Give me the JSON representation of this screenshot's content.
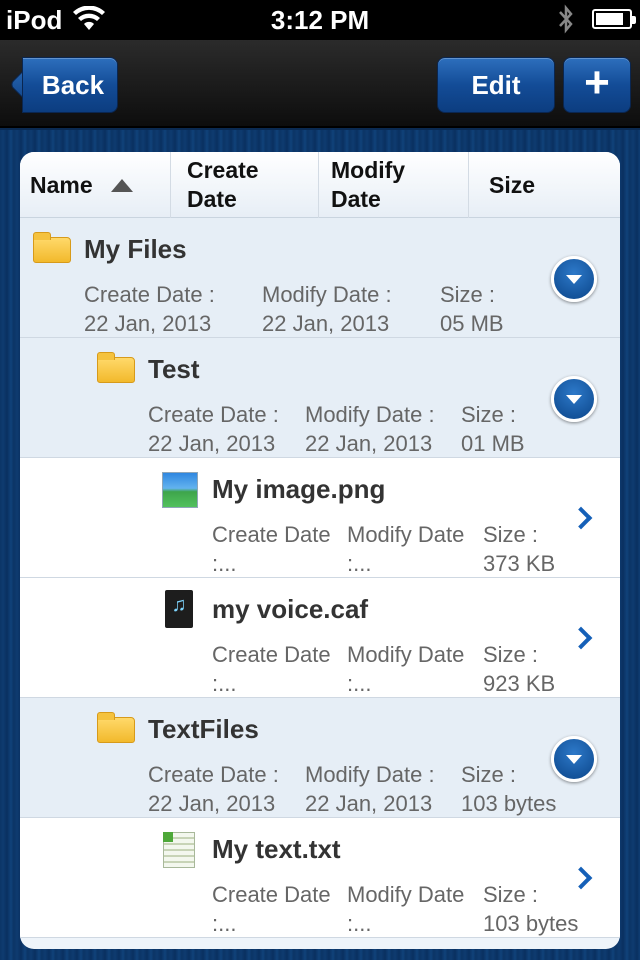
{
  "status_bar": {
    "carrier": "iPod",
    "time": "3:12 PM",
    "battery_level": 0.85
  },
  "nav_bar": {
    "back_label": "Back",
    "edit_label": "Edit",
    "add_label": "+"
  },
  "table_header": {
    "name": "Name",
    "create_date": "Create\nDate",
    "modify_date": "Modify\nDate",
    "size": "Size"
  },
  "rows": [
    {
      "type": "folder",
      "name": "My Files",
      "create_label": "Create Date :",
      "create_value": "22 Jan, 2013",
      "modify_label": "Modify Date :",
      "modify_value": "22 Jan, 2013",
      "size_label": "Size :",
      "size_value": "05 MB"
    },
    {
      "type": "folder",
      "name": "Test",
      "create_label": "Create Date :",
      "create_value": "22 Jan, 2013",
      "modify_label": "Modify Date :",
      "modify_value": "22 Jan, 2013",
      "size_label": "Size :",
      "size_value": "01 MB"
    },
    {
      "type": "file",
      "icon": "image-file-icon",
      "name": "My image.png",
      "create_label": "Create Date",
      "create_value": ":...",
      "modify_label": "Modify Date",
      "modify_value": ":...",
      "size_label": "Size :",
      "size_value": "373 KB"
    },
    {
      "type": "file",
      "icon": "audio-file-icon",
      "name": "my voice.caf",
      "create_label": "Create Date",
      "create_value": ":...",
      "modify_label": "Modify Date",
      "modify_value": ":...",
      "size_label": "Size :",
      "size_value": "923 KB"
    },
    {
      "type": "folder",
      "name": "TextFiles",
      "create_label": "Create Date :",
      "create_value": "22 Jan, 2013",
      "modify_label": "Modify Date :",
      "modify_value": "22 Jan, 2013",
      "size_label": "Size :",
      "size_value": "103 bytes"
    },
    {
      "type": "file",
      "icon": "text-file-icon",
      "name": "My text.txt",
      "create_label": "Create Date",
      "create_value": ":...",
      "modify_label": "Modify Date",
      "modify_value": ":...",
      "size_label": "Size :",
      "size_value": "103 bytes"
    }
  ]
}
